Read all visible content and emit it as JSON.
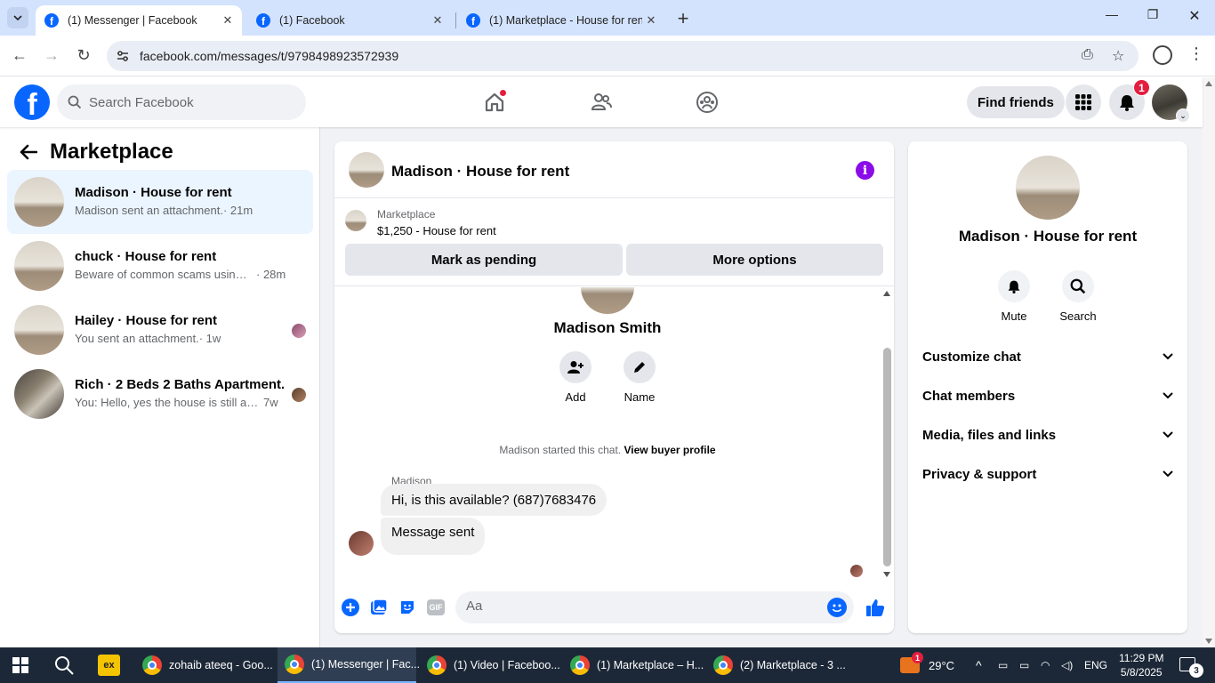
{
  "browser": {
    "tabs": [
      {
        "title": "(1) Messenger | Facebook",
        "active": true
      },
      {
        "title": "(1) Facebook",
        "active": false
      },
      {
        "title": "(1) Marketplace - House for ren",
        "active": false
      }
    ],
    "url": "facebook.com/messages/t/9798498923572939"
  },
  "fb_header": {
    "search_placeholder": "Search Facebook",
    "find_friends_label": "Find friends",
    "notification_count": "1",
    "colors": {
      "brand": "#0866ff",
      "badge": "#e41e3f"
    }
  },
  "sidebar": {
    "title": "Marketplace",
    "conversations": [
      {
        "title": "Madison · House for rent",
        "snippet": "Madison sent an attachment.",
        "time": "· 21m",
        "active": true
      },
      {
        "title": "chuck · House for rent",
        "snippet": "Beware of common scams using pa...",
        "time": "· 28m",
        "active": false
      },
      {
        "title": "Hailey · House for rent",
        "snippet": "You sent an attachment.",
        "time": "· 1w",
        "active": false
      },
      {
        "title": "Rich · 2 Beds 2 Baths Apartment...",
        "snippet": "You: Hello, yes the house is still ava...",
        "time": " 7w",
        "active": false
      }
    ]
  },
  "chat": {
    "header_name": "Madison · House for rent",
    "marketplace_label": "Marketplace",
    "listing": "$1,250 - House for rent",
    "mark_pending_label": "Mark as pending",
    "more_options_label": "More options",
    "contact_name": "Madison Smith",
    "actions": [
      {
        "label": "Add"
      },
      {
        "label": "Name"
      }
    ],
    "started_text": "Madison started this chat.",
    "view_buyer_profile": "View buyer profile",
    "sender_label": "Madison",
    "messages": [
      {
        "text": "Hi, is this available? (687)7683476"
      },
      {
        "text": "Message sent"
      }
    ],
    "composer_placeholder": "Aa",
    "gif_label": "GIF",
    "accent_color": "#0866ff"
  },
  "details": {
    "name": "Madison · House for rent",
    "actions": [
      {
        "label": "Mute"
      },
      {
        "label": "Search"
      }
    ],
    "sections": [
      {
        "label": "Customize chat"
      },
      {
        "label": "Chat members"
      },
      {
        "label": "Media, files and links"
      },
      {
        "label": "Privacy & support"
      }
    ]
  },
  "taskbar": {
    "apps": [
      {
        "title": "zohaib ateeq - Goo...",
        "active": false
      },
      {
        "title": "(1) Messenger | Fac...",
        "active": true
      },
      {
        "title": "(1) Video | Faceboo...",
        "active": false
      },
      {
        "title": "(1) Marketplace – H...",
        "active": false
      },
      {
        "title": "(2) Marketplace - 3 ...",
        "active": false
      }
    ],
    "express_label": "ex",
    "weather_badge": "1",
    "temperature": "29°C",
    "language": "ENG",
    "time": "11:29 PM",
    "date": "5/8/2025",
    "notifications": "3"
  }
}
